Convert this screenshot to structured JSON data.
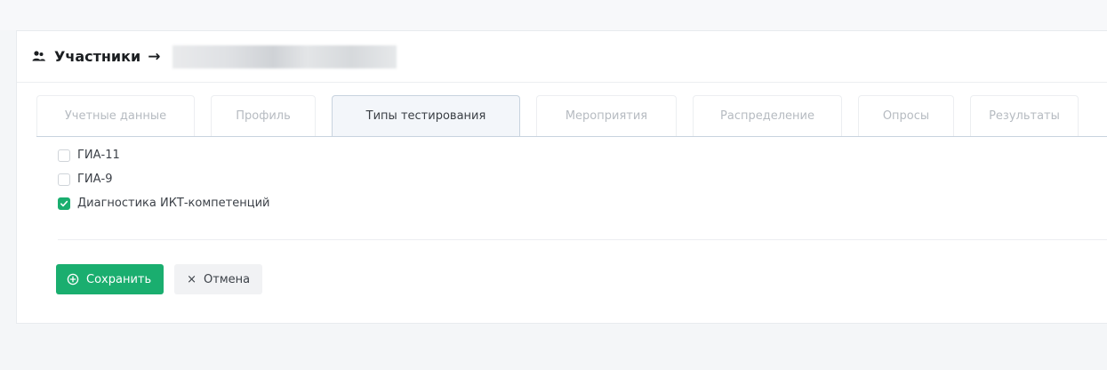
{
  "header": {
    "title": "Участники",
    "arrow": "→"
  },
  "tabs": [
    {
      "label": "Учетные данные",
      "active": false
    },
    {
      "label": "Профиль",
      "active": false
    },
    {
      "label": "Типы тестирования",
      "active": true
    },
    {
      "label": "Мероприятия",
      "active": false
    },
    {
      "label": "Распределение",
      "active": false
    },
    {
      "label": "Опросы",
      "active": false
    },
    {
      "label": "Результаты",
      "active": false
    }
  ],
  "checklist": [
    {
      "label": "ГИА-11",
      "checked": false
    },
    {
      "label": "ГИА-9",
      "checked": false
    },
    {
      "label": "Диагностика ИКТ-компетенций",
      "checked": true
    }
  ],
  "buttons": {
    "save_label": "Сохранить",
    "cancel_label": "Отмена",
    "cancel_glyph": "×"
  },
  "colors": {
    "accent": "#1aae6f",
    "tab_active_border": "#c8d3df",
    "muted_text": "#b6bbc1"
  },
  "icons": {
    "header": "users-icon",
    "save": "plus-circle-icon",
    "cancel": "close-icon",
    "checked": "checkmark-icon"
  }
}
